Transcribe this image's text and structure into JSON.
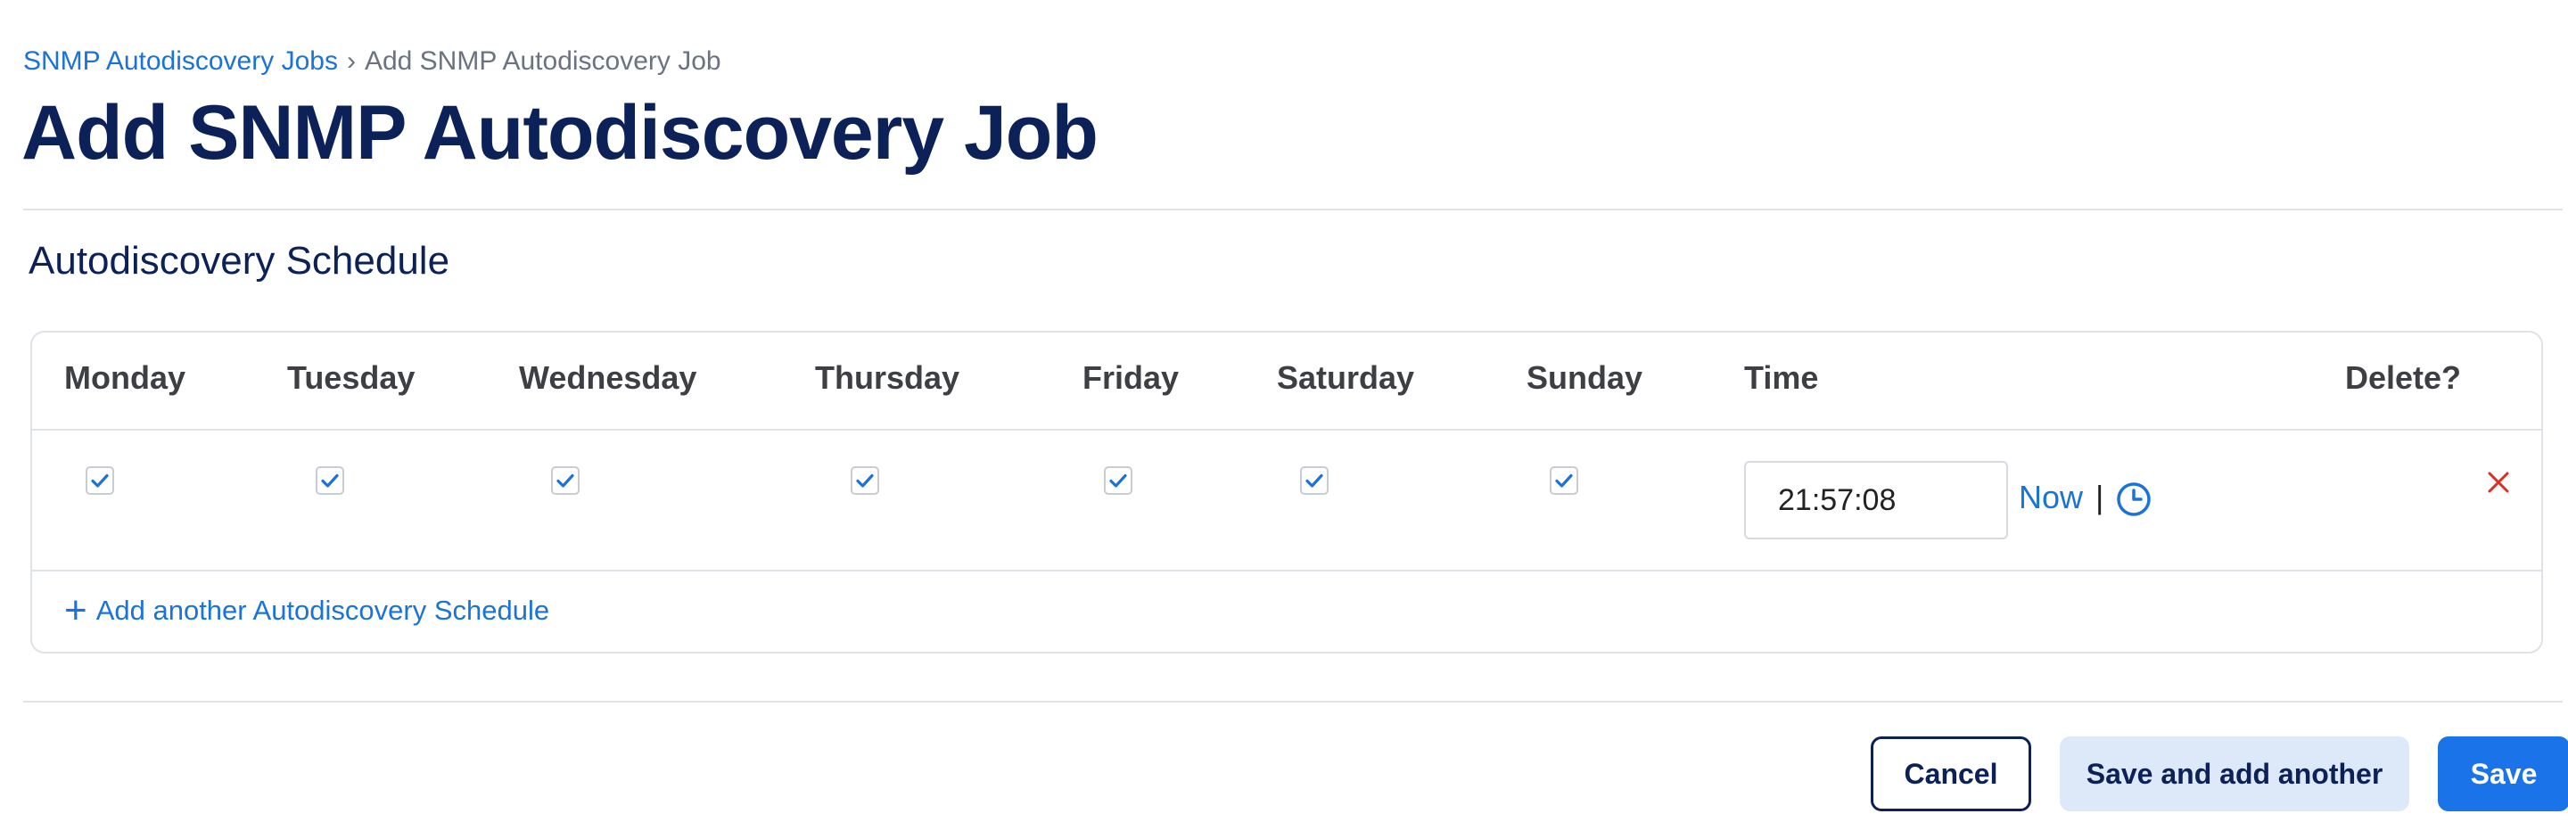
{
  "breadcrumb": {
    "parent": "SNMP Autodiscovery Jobs",
    "separator": "›",
    "current": "Add SNMP Autodiscovery Job"
  },
  "page_title": "Add SNMP Autodiscovery Job",
  "section_title": "Autodiscovery Schedule",
  "schedule_table": {
    "headers": {
      "monday": "Monday",
      "tuesday": "Tuesday",
      "wednesday": "Wednesday",
      "thursday": "Thursday",
      "friday": "Friday",
      "saturday": "Saturday",
      "sunday": "Sunday",
      "time": "Time",
      "delete": "Delete?"
    },
    "rows": [
      {
        "monday": true,
        "tuesday": true,
        "wednesday": true,
        "thursday": true,
        "friday": true,
        "saturday": true,
        "sunday": true,
        "time": "21:57:08",
        "now_label": "Now",
        "separator": "|",
        "clock_icon": "clock-icon",
        "delete_icon": "close-icon"
      }
    ],
    "add_label": "Add another Autodiscovery Schedule",
    "add_icon": "plus-icon"
  },
  "actions": {
    "cancel": "Cancel",
    "save_and_add": "Save and add another",
    "save": "Save"
  },
  "colors": {
    "brand_dark": "#0b2158",
    "link": "#1a73d9",
    "primary": "#1a73e8",
    "secondary_bg": "#dde8f8",
    "delete": "#d93025"
  }
}
